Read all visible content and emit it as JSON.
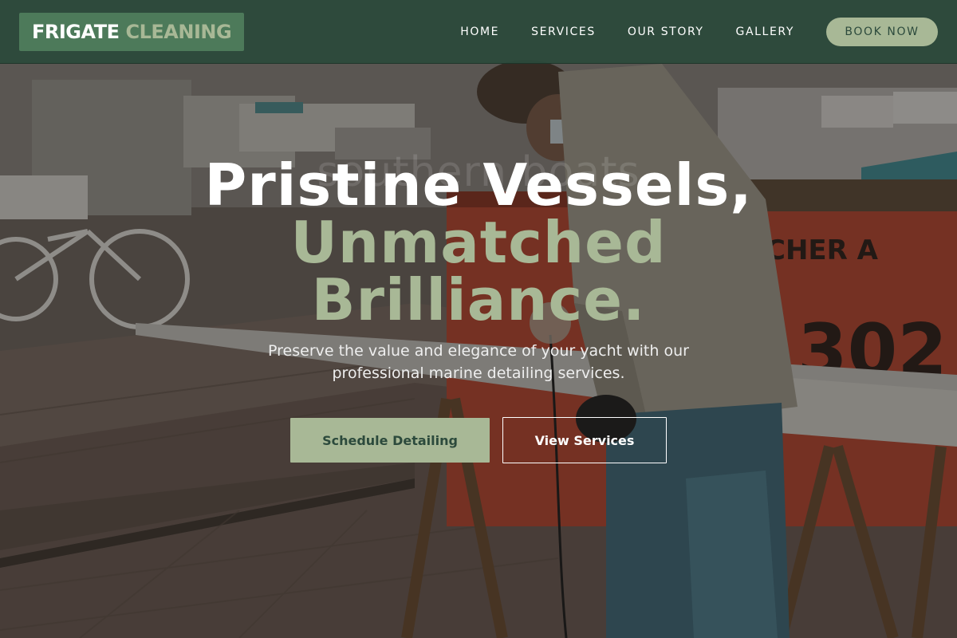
{
  "brand": {
    "name_first": "FRIGATE",
    "name_second": "CLEANING"
  },
  "nav": {
    "links": [
      {
        "label": "HOME"
      },
      {
        "label": "SERVICES"
      },
      {
        "label": "OUR STORY"
      },
      {
        "label": "GALLERY"
      }
    ],
    "book_label": "BOOK NOW"
  },
  "hero": {
    "title_line1": "Pristine Vessels,",
    "title_line2": "Unmatched Brilliance.",
    "background_text": "southern.boats",
    "subtitle": "Preserve the value and elegance of your yacht with our professional marine detailing services.",
    "primary_cta": "Schedule Detailing",
    "secondary_cta": "View Services"
  },
  "colors": {
    "header_bg": "#2c4a3c",
    "logo_bg": "#4d7a5a",
    "accent": "#a8b896",
    "text_light": "#ffffff"
  }
}
